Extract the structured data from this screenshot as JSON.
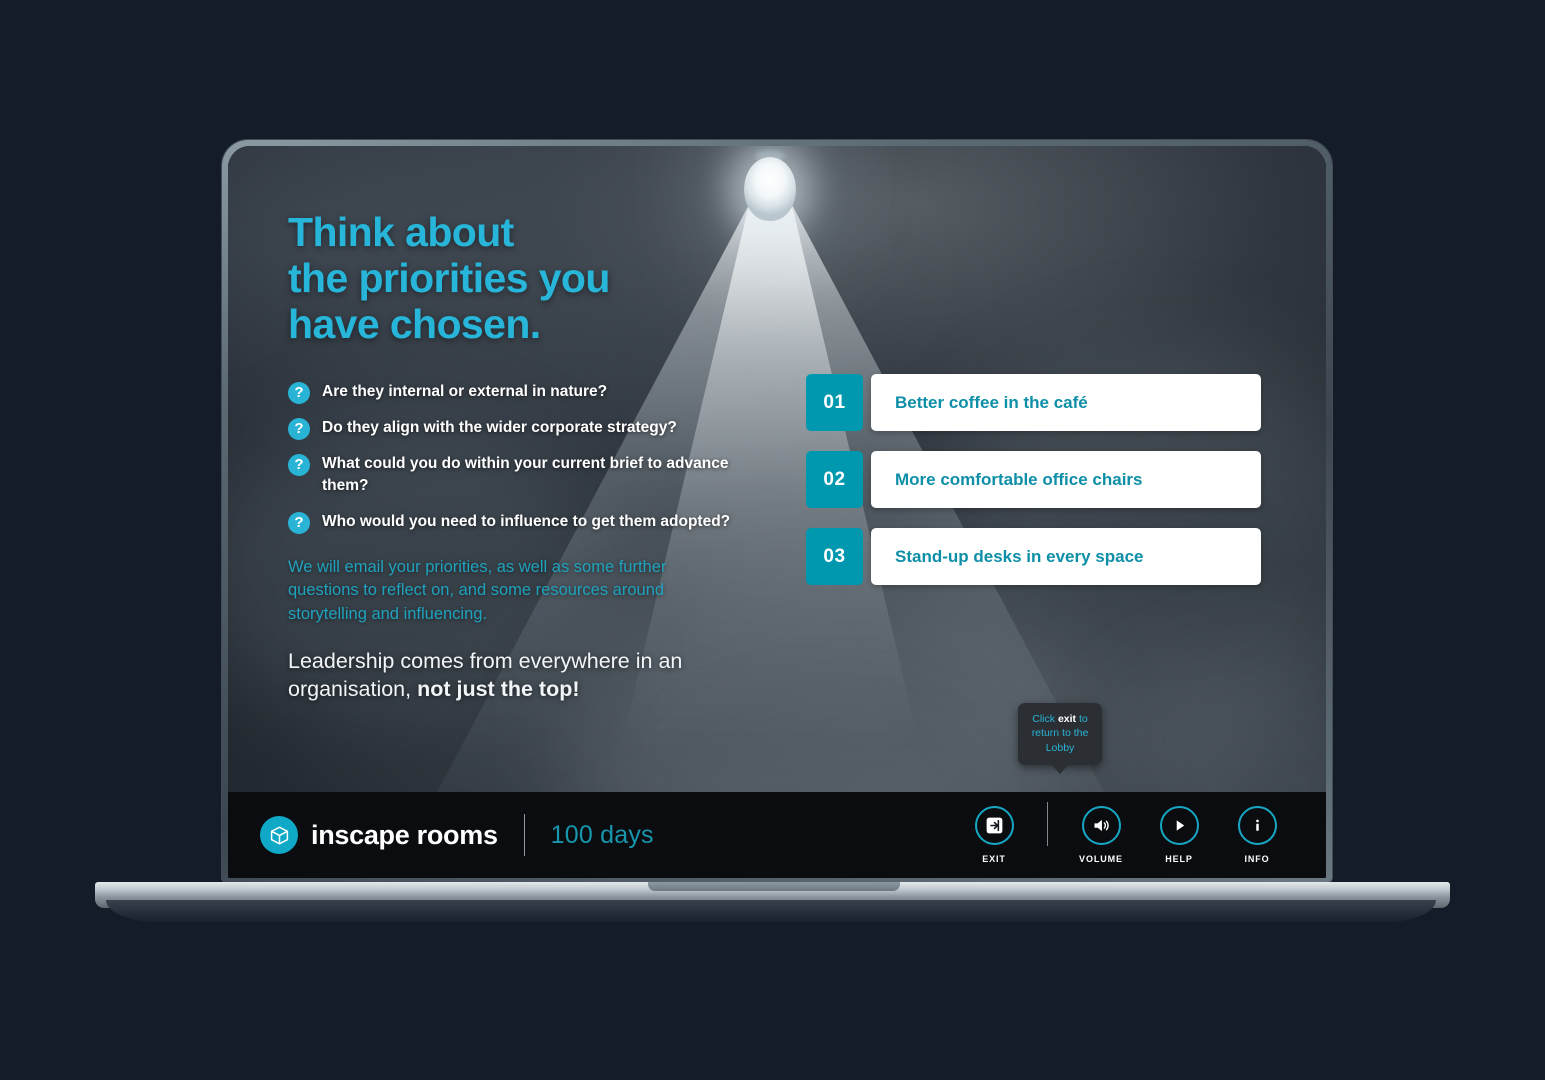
{
  "scene": {
    "background_color": "#151c29",
    "accent_cyan": "#27b6d9",
    "accent_teal": "#0098af",
    "lamp_icon": "spotlight-lamp-icon"
  },
  "slide": {
    "headline_line1": "Think about",
    "headline_line2": "the priorities you",
    "headline_line3": "have chosen.",
    "questions": [
      {
        "icon": "question-mark-icon",
        "text": "Are they internal or external in nature?"
      },
      {
        "icon": "question-mark-icon",
        "text": "Do they align with the wider corporate strategy?"
      },
      {
        "icon": "question-mark-icon",
        "text": "What could you do within your current brief to advance them?"
      },
      {
        "icon": "question-mark-icon",
        "text": "Who would you need to influence to get them adopted?"
      }
    ],
    "email_note": "We will email your priorities, as well as some further questions to reflect on, and some resources around storytelling and influencing.",
    "closing_normal": "Leadership comes from everywhere in an organisation, ",
    "closing_bold": "not just the top!"
  },
  "priorities": [
    {
      "number": "01",
      "label": "Better coffee in the café"
    },
    {
      "number": "02",
      "label": "More comfortable office chairs"
    },
    {
      "number": "03",
      "label": "Stand-up desks in every space"
    }
  ],
  "tooltip": {
    "prefix": "Click ",
    "emphasis": "exit",
    "suffix": " to return to the Lobby"
  },
  "footer": {
    "logo_icon": "cube-box-icon",
    "brand_name": "inscape rooms",
    "days_label": "100 days",
    "controls": [
      {
        "label": "EXIT",
        "icon": "exit-arrow-icon"
      },
      {
        "label": "VOLUME",
        "icon": "speaker-icon"
      },
      {
        "label": "HELP",
        "icon": "play-triangle-icon"
      },
      {
        "label": "INFO",
        "icon": "info-i-icon"
      }
    ]
  }
}
